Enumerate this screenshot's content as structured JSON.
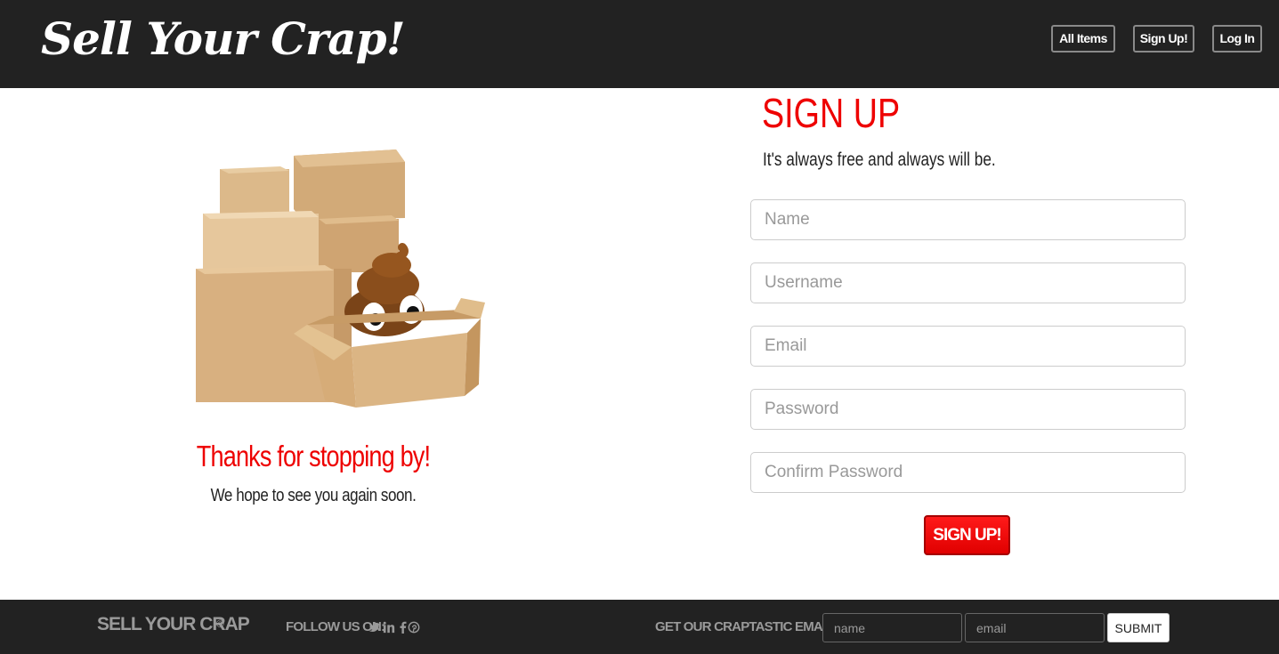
{
  "header": {
    "logo": "Sell Your Crap!",
    "nav": {
      "all_items": "All Items",
      "sign_up": "Sign Up!",
      "log_in": "Log In"
    }
  },
  "hero": {
    "title": "Thanks for stopping by!",
    "subtitle": "We hope to see you again soon."
  },
  "signup": {
    "title": "SIGN UP",
    "subtitle": "It's always free and always will be.",
    "fields": {
      "name": "Name",
      "username": "Username",
      "email": "Email",
      "password": "Password",
      "confirm_password": "Confirm Password"
    },
    "button": "SIGN UP!"
  },
  "footer": {
    "brand": "SELL YOUR CRAP",
    "copyright_symbol": "©",
    "follow_label": "FOLLOW US ON:",
    "social_icons": [
      "twitter-icon",
      "linkedin-icon",
      "facebook-icon",
      "pinterest-icon"
    ],
    "newsletter_label": "GET OUR CRAPTASTIC EMAILS!",
    "name_placeholder": "name",
    "email_placeholder": "email",
    "submit": "SUBMIT"
  },
  "colors": {
    "accent": "#ee0000",
    "dark": "#222222",
    "muted": "#9a9a9a"
  }
}
